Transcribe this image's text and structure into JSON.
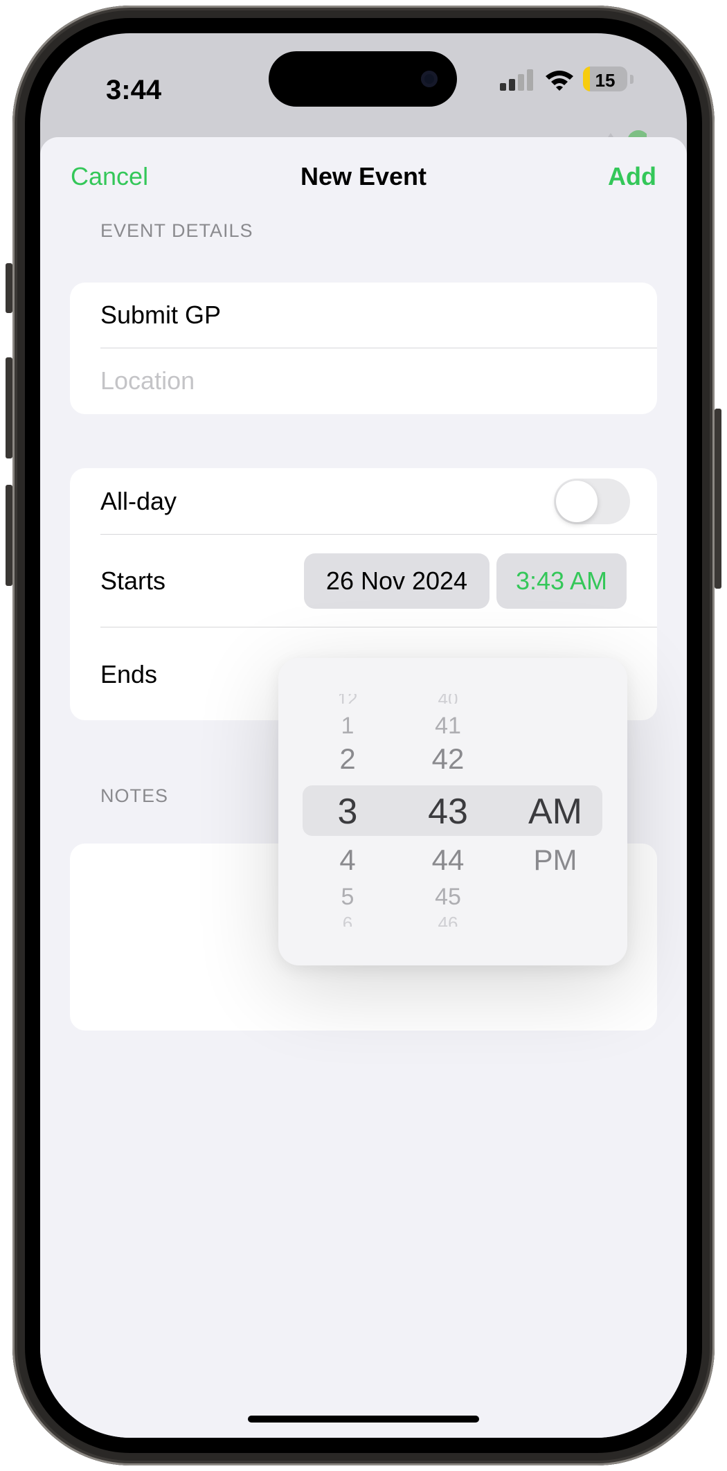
{
  "status_bar": {
    "time": "3:44",
    "battery_percent": "15",
    "battery_level": 0.15,
    "icons": [
      "cellular-signal-icon",
      "wifi-icon",
      "battery-icon"
    ]
  },
  "colors": {
    "accent": "#34c759",
    "sheet_background": "#f2f2f7",
    "battery_fill": "#f7cc0e"
  },
  "nav": {
    "cancel_label": "Cancel",
    "title": "New Event",
    "add_label": "Add"
  },
  "event_details": {
    "header": "EVENT DETAILS",
    "title_value": "Submit GP",
    "location_placeholder": "Location"
  },
  "timing": {
    "all_day_label": "All-day",
    "all_day_on": false,
    "starts_label": "Starts",
    "start_date": "26 Nov 2024",
    "start_time": "3:43 AM",
    "ends_label": "Ends"
  },
  "notes": {
    "header": "NOTES"
  },
  "time_picker": {
    "hours": {
      "above3": "12",
      "above2": "1",
      "above1": "2",
      "selected": "3",
      "below1": "4",
      "below2": "5",
      "below3": "6"
    },
    "minutes": {
      "above3": "40",
      "above2": "41",
      "above1": "42",
      "selected": "43",
      "below1": "44",
      "below2": "45",
      "below3": "46"
    },
    "period": {
      "selected": "AM",
      "below1": "PM"
    }
  }
}
